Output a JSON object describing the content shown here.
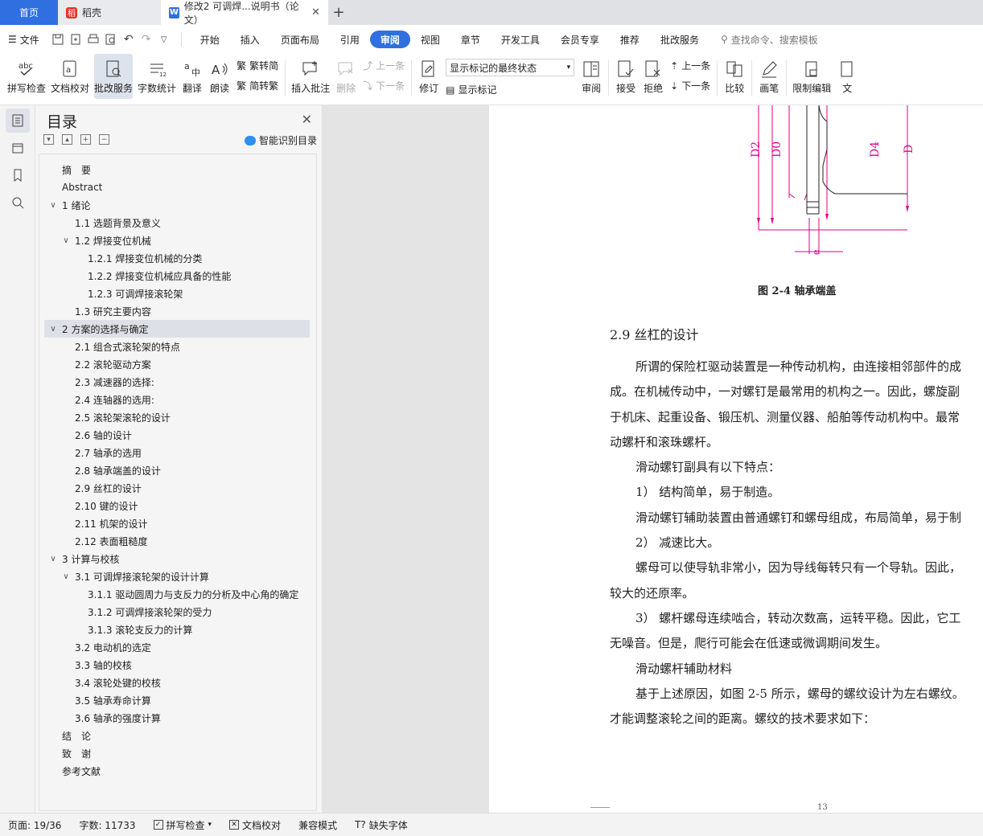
{
  "tabs": {
    "home": "首页",
    "daoke": "稻壳",
    "doc": "修改2 可调焊...说明书（论文）"
  },
  "menubar": {
    "file": "文件",
    "items": [
      "开始",
      "插入",
      "页面布局",
      "引用",
      "审阅",
      "视图",
      "章节",
      "开发工具",
      "会员专享",
      "推荐",
      "批改服务"
    ],
    "active": "审阅",
    "search": "查找命令、搜索模板"
  },
  "ribbon": {
    "spell": "拼写检查",
    "proof": "文档校对",
    "correct": "批改服务",
    "wordcount": "字数统计",
    "translate": "翻译",
    "read": "朗读",
    "trad": "繁转简",
    "simp": "简转繁",
    "insert_comment": "插入批注",
    "delete": "删除",
    "prev": "上一条",
    "next": "下一条",
    "revise": "修订",
    "markup_state": "显示标记的最终状态",
    "show_markup": "显示标记",
    "review": "审阅",
    "accept": "接受",
    "reject": "拒绝",
    "prev2": "上一条",
    "next2": "下一条",
    "compare": "比较",
    "pen": "画笔",
    "restrict": "限制编辑",
    "doc_more": "文"
  },
  "toc": {
    "title": "目录",
    "smart": "智能识别目录",
    "items": [
      {
        "text": "摘　要",
        "level": 0,
        "arrow": ""
      },
      {
        "text": "Abstract",
        "level": 0,
        "arrow": ""
      },
      {
        "text": "1  绪论",
        "level": 0,
        "arrow": "v"
      },
      {
        "text": "1.1 选题背景及意义",
        "level": 1,
        "arrow": ""
      },
      {
        "text": "1.2 焊接变位机械",
        "level": 1,
        "arrow": "v"
      },
      {
        "text": "1.2.1 焊接变位机械的分类",
        "level": 2,
        "arrow": ""
      },
      {
        "text": "1.2.2 焊接变位机械应具备的性能",
        "level": 2,
        "arrow": ""
      },
      {
        "text": "1.2.3 可调焊接滚轮架",
        "level": 2,
        "arrow": ""
      },
      {
        "text": "1.3  研究主要内容",
        "level": 1,
        "arrow": ""
      },
      {
        "text": "2  方案的选择与确定",
        "level": 0,
        "arrow": "v",
        "selected": true
      },
      {
        "text": "2.1 组合式滚轮架的特点",
        "level": 1,
        "arrow": ""
      },
      {
        "text": "2.2 滚轮驱动方案",
        "level": 1,
        "arrow": ""
      },
      {
        "text": "2.3 减速器的选择:",
        "level": 1,
        "arrow": ""
      },
      {
        "text": "2.4 连轴器的选用:",
        "level": 1,
        "arrow": ""
      },
      {
        "text": "2.5 滚轮架滚轮的设计",
        "level": 1,
        "arrow": ""
      },
      {
        "text": "2.6 轴的设计",
        "level": 1,
        "arrow": ""
      },
      {
        "text": "2.7 轴承的选用",
        "level": 1,
        "arrow": ""
      },
      {
        "text": "2.8 轴承端盖的设计",
        "level": 1,
        "arrow": ""
      },
      {
        "text": "2.9 丝杠的设计",
        "level": 1,
        "arrow": ""
      },
      {
        "text": "2.10 键的设计",
        "level": 1,
        "arrow": ""
      },
      {
        "text": "2.11 机架的设计",
        "level": 1,
        "arrow": ""
      },
      {
        "text": "2.12 表面粗糙度",
        "level": 1,
        "arrow": ""
      },
      {
        "text": "3  计算与校核",
        "level": 0,
        "arrow": "v"
      },
      {
        "text": "3.1 可调焊接滚轮架的设计计算",
        "level": 1,
        "arrow": "v"
      },
      {
        "text": "3.1.1 驱动圆周力与支反力的分析及中心角的确定",
        "level": 2,
        "arrow": ""
      },
      {
        "text": "3.1.2  可调焊接滚轮架的受力",
        "level": 2,
        "arrow": ""
      },
      {
        "text": "3.1.3 滚轮支反力的计算",
        "level": 2,
        "arrow": ""
      },
      {
        "text": "3.2 电动机的选定",
        "level": 1,
        "arrow": ""
      },
      {
        "text": "3.3 轴的校核",
        "level": 1,
        "arrow": ""
      },
      {
        "text": "3.4 滚轮处键的校核",
        "level": 1,
        "arrow": ""
      },
      {
        "text": "3.5 轴承寿命计算",
        "level": 1,
        "arrow": ""
      },
      {
        "text": "3.6 轴承的强度计算",
        "level": 1,
        "arrow": ""
      },
      {
        "text": "结　论",
        "level": 0,
        "arrow": ""
      },
      {
        "text": "致　谢",
        "level": 0,
        "arrow": ""
      },
      {
        "text": "参考文献",
        "level": 0,
        "arrow": ""
      }
    ]
  },
  "document": {
    "drawing_labels": [
      "D2",
      "D0",
      "D4",
      "D",
      "e"
    ],
    "caption": "图 2-4  轴承端盖",
    "heading": "2.9 丝杠的设计",
    "lines": [
      {
        "text": "所谓的保险杠驱动装置是一种传动机构，由连接相邻部件的成",
        "indent": true
      },
      {
        "text": "成。在机械传动中，一对螺钉是最常用的机构之一。因此，螺旋副",
        "indent": false
      },
      {
        "text": "于机床、起重设备、锻压机、测量仪器、船舶等传动机构中。最常",
        "indent": false
      },
      {
        "text": "动螺杆和滚珠螺杆。",
        "indent": false
      },
      {
        "text": "滑动螺钉副具有以下特点：",
        "indent": true
      },
      {
        "text": "1）  结构简单，易于制造。",
        "indent": true
      },
      {
        "text": "滑动螺钉辅助装置由普通螺钉和螺母组成，布局简单，易于制",
        "indent": true
      },
      {
        "text": "2）  减速比大。",
        "indent": true
      },
      {
        "text": "螺母可以使导轨非常小，因为导线每转只有一个导轨。因此，",
        "indent": true
      },
      {
        "text": "较大的还原率。",
        "indent": false
      },
      {
        "text": "3）  螺杆螺母连续啮合，转动次数高，运转平稳。因此，它工",
        "indent": true
      },
      {
        "text": "无噪音。但是，爬行可能会在低速或微调期间发生。",
        "indent": false
      },
      {
        "text": "滑动螺杆辅助材料",
        "indent": true
      },
      {
        "text": "基于上述原因，如图 2-5 所示，螺母的螺纹设计为左右螺纹。",
        "indent": true
      },
      {
        "text": "才能调整滚轮之间的距离。螺纹的技术要求如下：",
        "indent": false
      }
    ],
    "page_number": "13"
  },
  "status": {
    "page": "页面: 19/36",
    "words": "字数: 11733",
    "spell": "拼写检查",
    "proof": "文档校对",
    "compat": "兼容模式",
    "missing_font": "缺失字体"
  },
  "colors": {
    "accent": "#2f6fe0",
    "drawing_pink": "#e0008a"
  }
}
